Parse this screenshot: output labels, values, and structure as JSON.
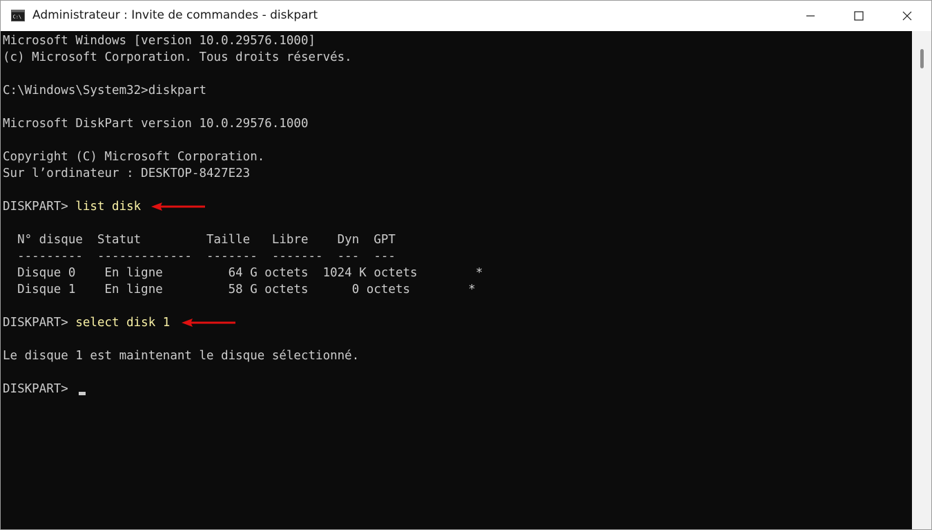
{
  "window": {
    "title": "Administrateur : Invite de commandes - diskpart"
  },
  "console": {
    "lines": {
      "l1": "Microsoft Windows [version 10.0.29576.1000]",
      "l2": "(c) Microsoft Corporation. Tous droits réservés.",
      "l4": "C:\\Windows\\System32>diskpart",
      "l6": "Microsoft DiskPart version 10.0.29576.1000",
      "l8": "Copyright (C) Microsoft Corporation.",
      "l9": "Sur l’ordinateur : DESKTOP-8427E23",
      "l11_prompt": "DISKPART> ",
      "l11_cmd": "list disk",
      "l13": "  N° disque  Statut         Taille   Libre    Dyn  GPT",
      "l14": "  ---------  -------------  -------  -------  ---  ---",
      "l15": "  Disque 0    En ligne         64 G octets  1024 K octets        *",
      "l16": "  Disque 1    En ligne         58 G octets      0 octets        *",
      "l18_prompt": "DISKPART> ",
      "l18_cmd": "select disk 1",
      "l20": "Le disque 1 est maintenant le disque sélectionné.",
      "l22_prompt": "DISKPART> "
    },
    "colors": {
      "background": "#0c0c0c",
      "text": "#cccccc",
      "command_highlight": "#f9f1a5",
      "annotation_arrow": "#e01010"
    }
  },
  "icons": {
    "app": "cmd-icon",
    "minimize": "minimize-icon",
    "maximize": "maximize-icon",
    "close": "close-icon",
    "annotation": "red-arrow-icon"
  }
}
